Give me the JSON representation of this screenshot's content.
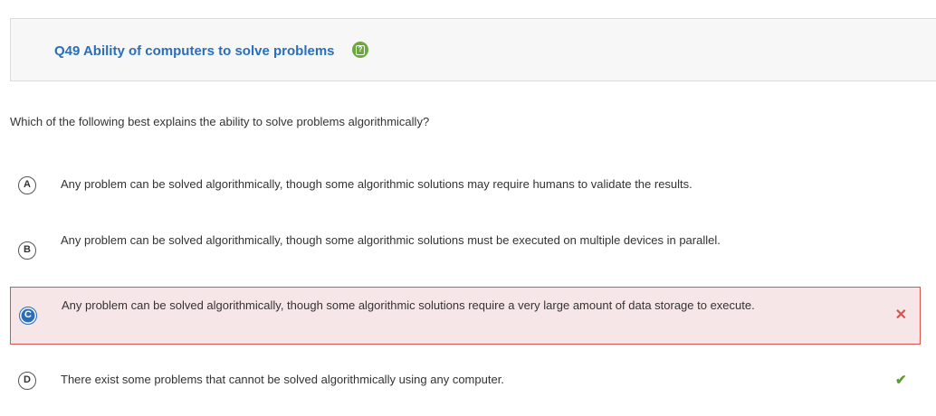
{
  "header": {
    "title": "Q49 Ability of computers to solve problems",
    "help_icon": "help-icon"
  },
  "question": {
    "text": "Which of the following best explains the ability to solve problems algorithmically?"
  },
  "options": [
    {
      "letter": "A",
      "text": "Any problem can be solved algorithmically, though some algorithmic solutions may require humans to validate the results."
    },
    {
      "letter": "B",
      "text": "Any problem can be solved algorithmically, though some algorithmic solutions must be executed on multiple devices in parallel."
    },
    {
      "letter": "C",
      "text": "Any problem can be solved algorithmically, though some algorithmic solutions require a very large amount of data storage to execute.",
      "state": "selected-incorrect",
      "mark": "✕"
    },
    {
      "letter": "D",
      "text": "There exist some problems that cannot be solved algorithmically using any computer.",
      "state": "correct",
      "mark": "✔"
    }
  ],
  "colors": {
    "title": "#2a6ebb",
    "incorrect": "#d9534f",
    "correct": "#5aa02c",
    "selected_bg": "#f7e6e7"
  }
}
